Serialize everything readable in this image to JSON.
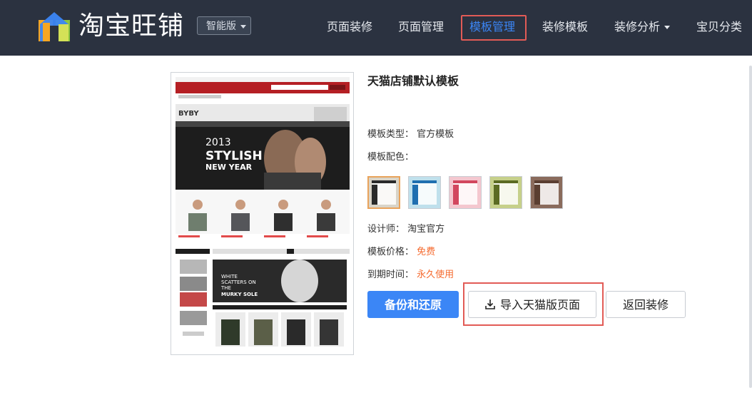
{
  "header": {
    "brand": "淘宝旺铺",
    "edition": "智能版",
    "nav": [
      {
        "label": "页面装修"
      },
      {
        "label": "页面管理"
      },
      {
        "label": "模板管理"
      },
      {
        "label": "装修模板"
      },
      {
        "label": "装修分析"
      },
      {
        "label": "宝贝分类"
      }
    ]
  },
  "thumbnail": {
    "headline_year": "2013",
    "headline_main": "STYLISH",
    "headline_sub": "NEW YEAR",
    "store_logo": "BYBY",
    "banner2_line1": "WHITE",
    "banner2_line2": "SCATTERS ON",
    "banner2_line3": "THE",
    "banner2_line4": "MURKY SOLE"
  },
  "template": {
    "title": "天猫店铺默认模板",
    "type_label": "模板类型：",
    "type_value": "官方模板",
    "color_label": "模板配色：",
    "designer_label": "设计师：",
    "designer_value": "淘宝官方",
    "price_label": "模板价格：",
    "price_value": "免费",
    "expire_label": "到期时间：",
    "expire_value": "永久使用"
  },
  "colors": {
    "swatches": [
      {
        "bg": "#d9d4c8",
        "bar": "#2a2a2a",
        "side": "#2a2a2a",
        "selected": true
      },
      {
        "bg": "#bfe0ec",
        "bar": "#1f6fb0",
        "side": "#1f6fb0",
        "selected": false
      },
      {
        "bg": "#f4c7cf",
        "bar": "#d2475e",
        "side": "#d2475e",
        "selected": false
      },
      {
        "bg": "#c6d08a",
        "bar": "#5b6b23",
        "side": "#5b6b23",
        "selected": false
      },
      {
        "bg": "#8a6b5c",
        "bar": "#5a3e31",
        "side": "#5a3e31",
        "selected": false
      }
    ],
    "accent": "#3b86f6",
    "highlight": "#e25b56",
    "price": "#f56a2e"
  },
  "actions": {
    "backup": "备份和还原",
    "import": "导入天猫版页面",
    "back": "返回装修"
  }
}
